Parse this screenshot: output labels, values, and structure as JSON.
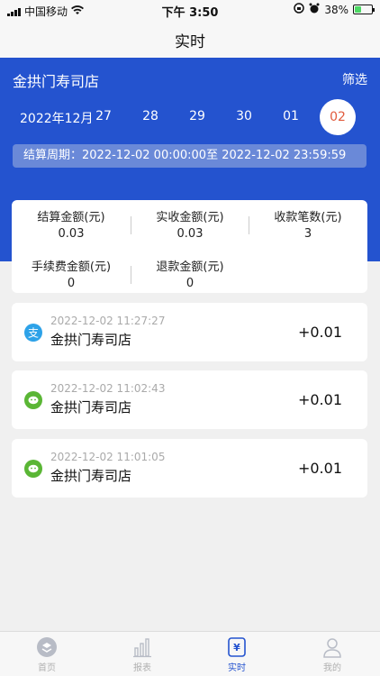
{
  "status_bar": {
    "carrier": "中国移动",
    "time": "下午 3:50",
    "battery": "38%",
    "battery_level": 0.38
  },
  "nav": {
    "title": "实时"
  },
  "header": {
    "store_name": "金拱门寿司店",
    "filter_label": "筛选",
    "month_label": "2022年12月",
    "dates": [
      "27",
      "28",
      "29",
      "30",
      "01",
      "02"
    ],
    "selected_date": "02",
    "period_text": "结算周期：2022-12-02 00:00:00至 2022-12-02 23:59:59"
  },
  "summary": {
    "settle_label": "结算金额(元)",
    "settle_value": "0.03",
    "received_label": "实收金额(元)",
    "received_value": "0.03",
    "count_label": "收款笔数(元)",
    "count_value": "3",
    "fee_label": "手续费金额(元)",
    "fee_value": "0",
    "refund_label": "退款金额(元)",
    "refund_value": "0"
  },
  "transactions": [
    {
      "method": "alipay",
      "icon": "alipay-icon",
      "time": "2022-12-02 11:27:27",
      "store": "金拱门寿司店",
      "amount": "+0.01"
    },
    {
      "method": "wechat",
      "icon": "wechat-pay-icon",
      "time": "2022-12-02 11:02:43",
      "store": "金拱门寿司店",
      "amount": "+0.01"
    },
    {
      "method": "wechat",
      "icon": "wechat-pay-icon",
      "time": "2022-12-02 11:01:05",
      "store": "金拱门寿司店",
      "amount": "+0.01"
    }
  ],
  "tabs": [
    {
      "label": "首页",
      "icon": "home-icon"
    },
    {
      "label": "报表",
      "icon": "report-chart-icon"
    },
    {
      "label": "实时",
      "icon": "yuan-realtime-icon",
      "active": true
    },
    {
      "label": "我的",
      "icon": "profile-icon"
    }
  ],
  "colors": {
    "primary": "#2453cf",
    "selected_date_text": "#e15a3c",
    "alipay": "#2da2e8",
    "wechat": "#5ab635"
  }
}
